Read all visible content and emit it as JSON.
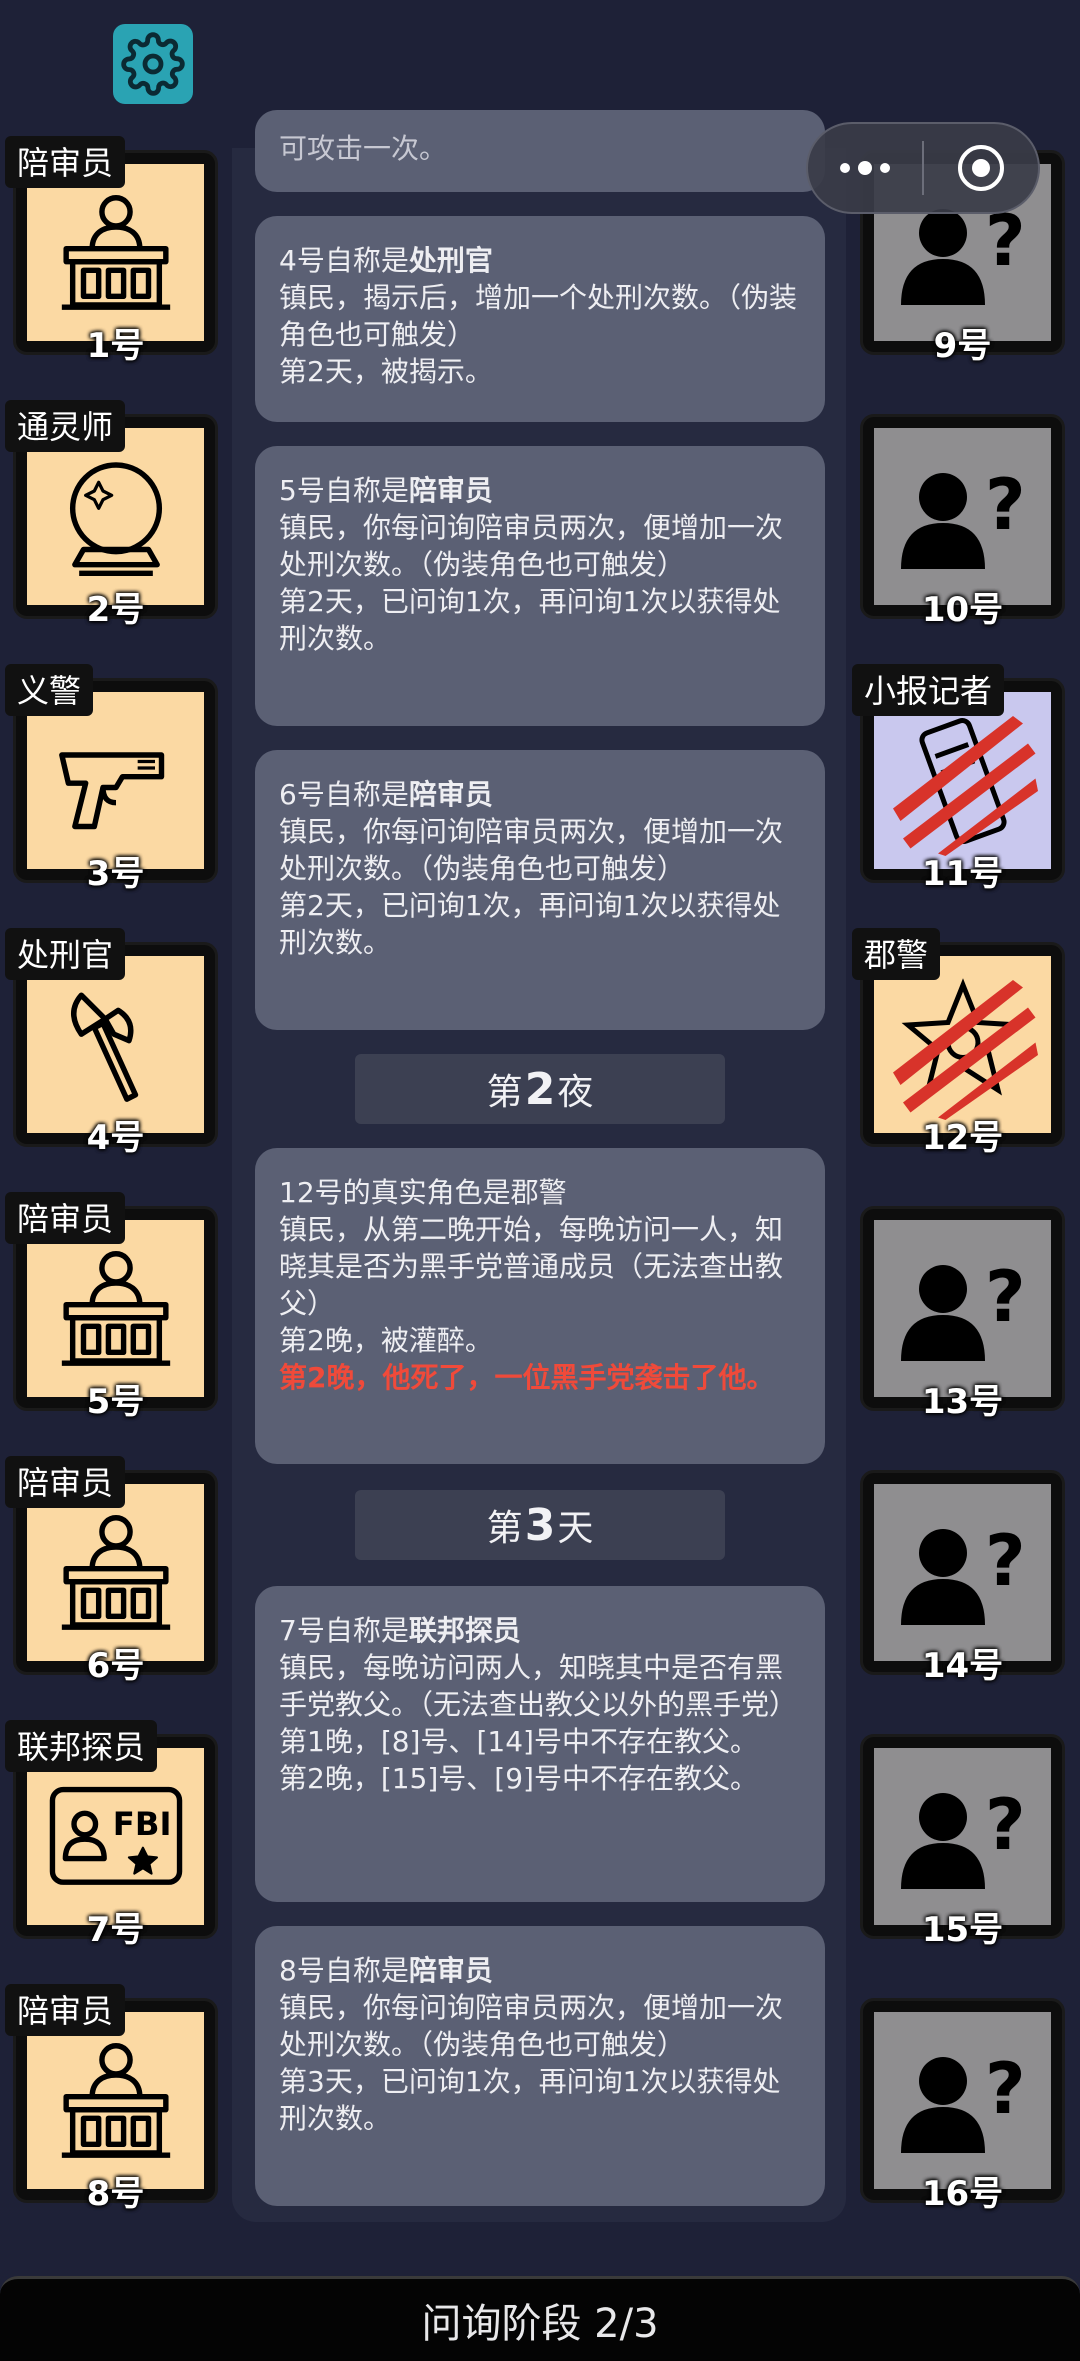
{
  "header": {
    "settings_icon": "gear-icon",
    "menu_icon": "more-dots-icon",
    "close_icon": "target-icon"
  },
  "timeline": {
    "top_snippet": "可攻击一次。",
    "cards": [
      {
        "prefix": "4号自称是",
        "role": "处刑官",
        "lines": [
          "镇民，揭示后，增加一个处刑次数。（伪装角色也可触发）",
          "第2天，被揭示。"
        ]
      },
      {
        "prefix": "5号自称是",
        "role": "陪审员",
        "lines": [
          "镇民，你每问询陪审员两次，便增加一次处刑次数。（伪装角色也可触发）",
          "第2天，已问询1次，再问询1次以获得处刑次数。"
        ]
      },
      {
        "prefix": "6号自称是",
        "role": "陪审员",
        "lines": [
          "镇民，你每问询陪审员两次，便增加一次处刑次数。（伪装角色也可触发）",
          "第2天，已问询1次，再问询1次以获得处刑次数。"
        ]
      },
      {
        "prefix": "12号的真实角色是郡警",
        "role": "",
        "lines": [
          "镇民，从第二晚开始，每晚访问一人，知晓其是否为黑手党普通成员（无法查出教父）",
          "第2晚，被灌醉。"
        ],
        "alert": "第2晚，他死了，一位黑手党袭击了他。"
      },
      {
        "prefix": "7号自称是",
        "role": "联邦探员",
        "lines": [
          "镇民，每晚访问两人，知晓其中是否有黑手党教父。（无法查出教父以外的黑手党）",
          "第1晚，[8]号、[14]号中不存在教父。",
          "第2晚，[15]号、[9]号中不存在教父。"
        ]
      },
      {
        "prefix": "8号自称是",
        "role": "陪审员",
        "lines": [
          "镇民，你每问询陪审员两次，便增加一次处刑次数。（伪装角色也可触发）",
          "第3天，已问询1次，再问询1次以获得处刑次数。"
        ]
      }
    ],
    "dividers": [
      {
        "pre": "第",
        "num": "2",
        "post": "夜"
      },
      {
        "pre": "第",
        "num": "3",
        "post": "天"
      }
    ]
  },
  "players_left": [
    {
      "num": "1号",
      "role": "陪审员",
      "icon": "juror-icon"
    },
    {
      "num": "2号",
      "role": "通灵师",
      "icon": "crystal-ball-icon"
    },
    {
      "num": "3号",
      "role": "义警",
      "icon": "pistol-icon"
    },
    {
      "num": "4号",
      "role": "处刑官",
      "icon": "axe-icon"
    },
    {
      "num": "5号",
      "role": "陪审员",
      "icon": "juror-icon"
    },
    {
      "num": "6号",
      "role": "陪审员",
      "icon": "juror-icon"
    },
    {
      "num": "7号",
      "role": "联邦探员",
      "icon": "fbi-badge-icon",
      "badge_text": "FBI"
    },
    {
      "num": "8号",
      "role": "陪审员",
      "icon": "juror-icon"
    }
  ],
  "players_right": [
    {
      "num": "9号",
      "role": "",
      "icon": "unknown-person-icon"
    },
    {
      "num": "10号",
      "role": "",
      "icon": "unknown-person-icon"
    },
    {
      "num": "11号",
      "role": "小报记者",
      "icon": "newspaper-icon",
      "status": "dead"
    },
    {
      "num": "12号",
      "role": "郡警",
      "icon": "sheriff-star-icon",
      "status": "dead"
    },
    {
      "num": "13号",
      "role": "",
      "icon": "unknown-person-icon"
    },
    {
      "num": "14号",
      "role": "",
      "icon": "unknown-person-icon"
    },
    {
      "num": "15号",
      "role": "",
      "icon": "unknown-person-icon"
    },
    {
      "num": "16号",
      "role": "",
      "icon": "unknown-person-icon"
    }
  ],
  "footer": {
    "phase": "问询阶段 2/3"
  },
  "colors": {
    "background": "#1e2137",
    "card": "#5b6074",
    "known_tile": "#fbd9a3",
    "unknown_tile": "#8f8e90",
    "alert": "#f04a3a",
    "settings_bg": "#2aa3b3"
  }
}
